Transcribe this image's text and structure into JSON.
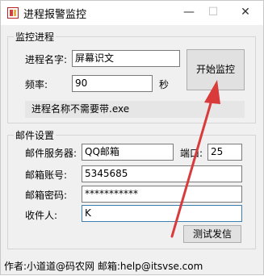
{
  "window": {
    "title": "进程报警监控",
    "minimize": "—",
    "maximize": "☐",
    "close": "✕"
  },
  "monitor": {
    "group_title": "监控进程",
    "process_label": "进程名字:",
    "process_value": "屏幕识文",
    "freq_label": "频率:",
    "freq_value": "90",
    "freq_unit": "秒",
    "start_button": "开始监控",
    "note": "进程名称不需要带.exe"
  },
  "mail": {
    "group_title": "邮件设置",
    "server_label": "邮件服务器:",
    "server_value": "QQ邮箱",
    "port_label": "端口:",
    "port_value": "25",
    "account_label": "邮箱账号:",
    "account_value": "5345685",
    "password_label": "邮箱密码:",
    "password_value": "***********",
    "recipient_label": "收件人:",
    "recipient_value": "K",
    "test_button": "测试发信"
  },
  "footer": {
    "text": "作者:小道道@码农网  邮箱:help@itsvse.com"
  },
  "colors": {
    "arrow": "#d93a3a",
    "focus_border": "#3c7fb1"
  }
}
